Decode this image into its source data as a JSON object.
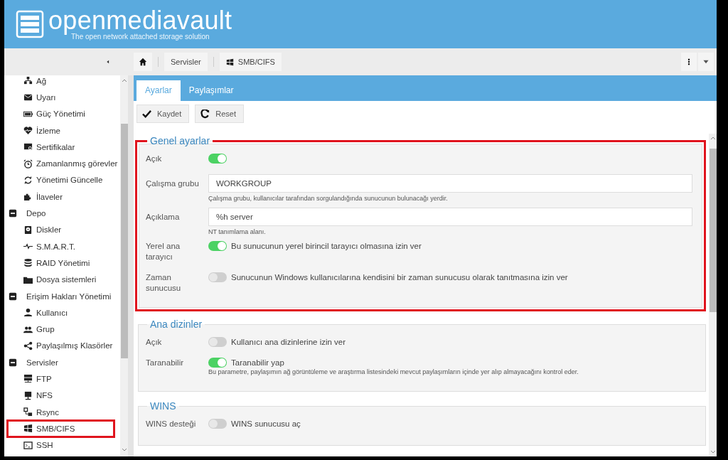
{
  "header": {
    "title": "openmediavault",
    "subtitle": "The open network attached storage solution"
  },
  "breadcrumb": [
    {
      "label": "Servisler"
    },
    {
      "label": "SMB/CIFS"
    }
  ],
  "sidebar": {
    "items": [
      {
        "kind": "item",
        "label": "Ağ",
        "highlighted": false
      },
      {
        "kind": "item",
        "label": "Uyarı",
        "highlighted": false
      },
      {
        "kind": "item",
        "label": "Güç Yönetimi",
        "highlighted": false
      },
      {
        "kind": "item",
        "label": "İzleme",
        "highlighted": false
      },
      {
        "kind": "item",
        "label": "Sertifikalar",
        "highlighted": false
      },
      {
        "kind": "item",
        "label": "Zamanlanmış görevler",
        "highlighted": false
      },
      {
        "kind": "item",
        "label": "Yönetimi Güncelle",
        "highlighted": false
      },
      {
        "kind": "item",
        "label": "İlaveler",
        "highlighted": false
      },
      {
        "kind": "group",
        "label": "Depo",
        "expanded": true,
        "highlighted": false,
        "children": [
          {
            "kind": "item",
            "label": "Diskler",
            "highlighted": false
          },
          {
            "kind": "item",
            "label": "S.M.A.R.T.",
            "highlighted": false
          },
          {
            "kind": "item",
            "label": "RAID Yönetimi",
            "highlighted": false
          },
          {
            "kind": "item",
            "label": "Dosya sistemleri",
            "highlighted": false
          }
        ]
      },
      {
        "kind": "group",
        "label": "Erişim Hakları Yönetimi",
        "expanded": true,
        "highlighted": false,
        "children": [
          {
            "kind": "item",
            "label": "Kullanıcı",
            "highlighted": false
          },
          {
            "kind": "item",
            "label": "Grup",
            "highlighted": false
          },
          {
            "kind": "item",
            "label": "Paylaşılmış Klasörler",
            "highlighted": false
          }
        ]
      },
      {
        "kind": "group",
        "label": "Servisler",
        "expanded": true,
        "highlighted": false,
        "children": [
          {
            "kind": "item",
            "label": "FTP",
            "highlighted": false
          },
          {
            "kind": "item",
            "label": "NFS",
            "highlighted": false
          },
          {
            "kind": "item",
            "label": "Rsync",
            "highlighted": false
          },
          {
            "kind": "item",
            "label": "SMB/CIFS",
            "highlighted": true
          },
          {
            "kind": "item",
            "label": "SSH",
            "highlighted": false
          }
        ]
      }
    ]
  },
  "tabs": [
    {
      "label": "Ayarlar",
      "selected": true
    },
    {
      "label": "Paylaşımlar",
      "selected": false
    }
  ],
  "buttons": [
    {
      "kind": "save",
      "label": "Kaydet"
    },
    {
      "kind": "reset",
      "label": "Reset"
    }
  ],
  "sections": [
    {
      "title": "Genel ayarlar",
      "highlighted": true,
      "fields": [
        {
          "kind": "switch",
          "label": "Açık",
          "on": true
        },
        {
          "kind": "text",
          "label": "Çalışma grubu",
          "value": "WORKGROUP",
          "hint": "Çalışma grubu, kullanıcılar tarafından sorgulandığında sunucunun bulunacağı yerdir."
        },
        {
          "kind": "text",
          "label": "Açıklama",
          "value": "%h server",
          "hint": "NT tanımlama alanı."
        },
        {
          "kind": "switch",
          "label": "Yerel ana tarayıcı",
          "on": true,
          "text": "Bu sunucunun yerel birincil tarayıcı olmasına izin ver"
        },
        {
          "kind": "switch",
          "label": "Zaman sunucusu",
          "on": false,
          "text": "Sunucunun Windows kullanıcılarına kendisini bir zaman sunucusu olarak tanıtmasına izin ver"
        }
      ]
    },
    {
      "title": "Ana dizinler",
      "highlighted": false,
      "fields": [
        {
          "kind": "switch",
          "label": "Açık",
          "on": false,
          "text": "Kullanıcı ana dizinlerine izin ver"
        },
        {
          "kind": "switch",
          "label": "Taranabilir",
          "on": true,
          "text": "Taranabilir yap",
          "hint": "Bu parametre, paylaşımın ağ görüntüleme ve araştırma listesindeki mevcut paylaşımların içinde yer alıp almayacağını kontrol eder."
        }
      ]
    },
    {
      "title": "WINS",
      "highlighted": false,
      "fields": [
        {
          "kind": "switch",
          "label": "WINS desteği",
          "on": false,
          "text": "WINS sunucusu aç"
        }
      ]
    }
  ]
}
